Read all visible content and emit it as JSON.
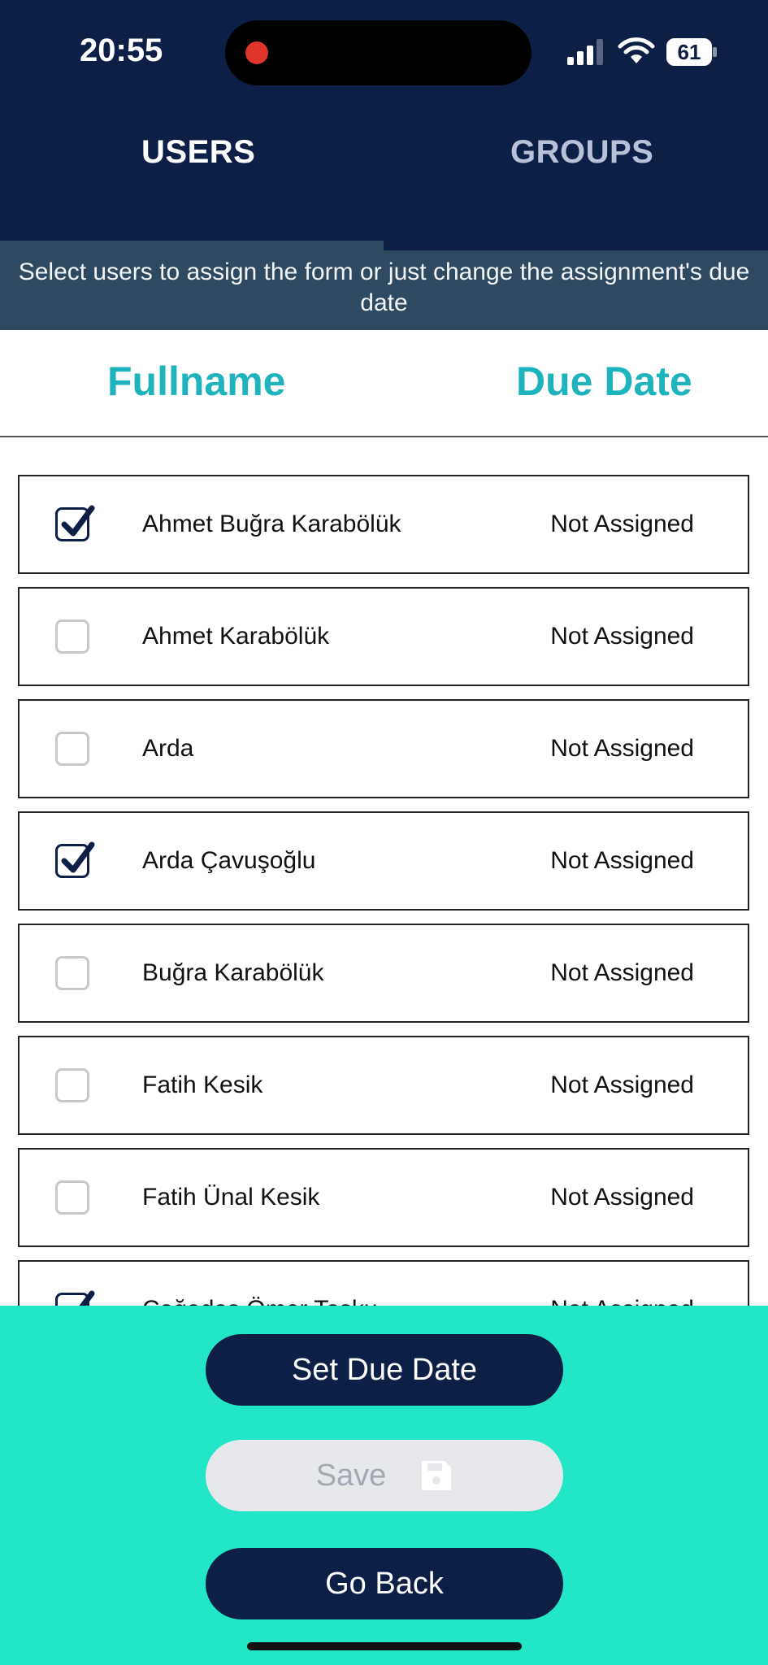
{
  "status_bar": {
    "time": "20:55",
    "battery": "61"
  },
  "tabs": [
    {
      "label": "USERS",
      "active": true
    },
    {
      "label": "GROUPS",
      "active": false
    }
  ],
  "banner": "Select users to assign the form or just change the assignment's due date",
  "columns": {
    "fullname": "Fullname",
    "due_date": "Due Date"
  },
  "users": [
    {
      "name": "Ahmet Buğra Karabölük",
      "due": "Not Assigned",
      "checked": true
    },
    {
      "name": "Ahmet Karabölük",
      "due": "Not Assigned",
      "checked": false
    },
    {
      "name": "Arda",
      "due": "Not Assigned",
      "checked": false
    },
    {
      "name": "Arda Çavuşoğlu",
      "due": "Not Assigned",
      "checked": true
    },
    {
      "name": "Buğra Karabölük",
      "due": "Not Assigned",
      "checked": false
    },
    {
      "name": "Fatih Kesik",
      "due": "Not Assigned",
      "checked": false
    },
    {
      "name": "Fatih Ünal Kesik",
      "due": "Not Assigned",
      "checked": false
    },
    {
      "name": "Çağadaş Ömer Tosku",
      "due": "Not Assigned",
      "checked": true
    }
  ],
  "buttons": {
    "set_due_date": "Set Due Date",
    "save": "Save",
    "go_back": "Go Back"
  },
  "colors": {
    "navy": "#0e1f47",
    "teal_accent": "#1fb3be",
    "panel": "#22e6c6",
    "banner": "#2f4a60"
  }
}
